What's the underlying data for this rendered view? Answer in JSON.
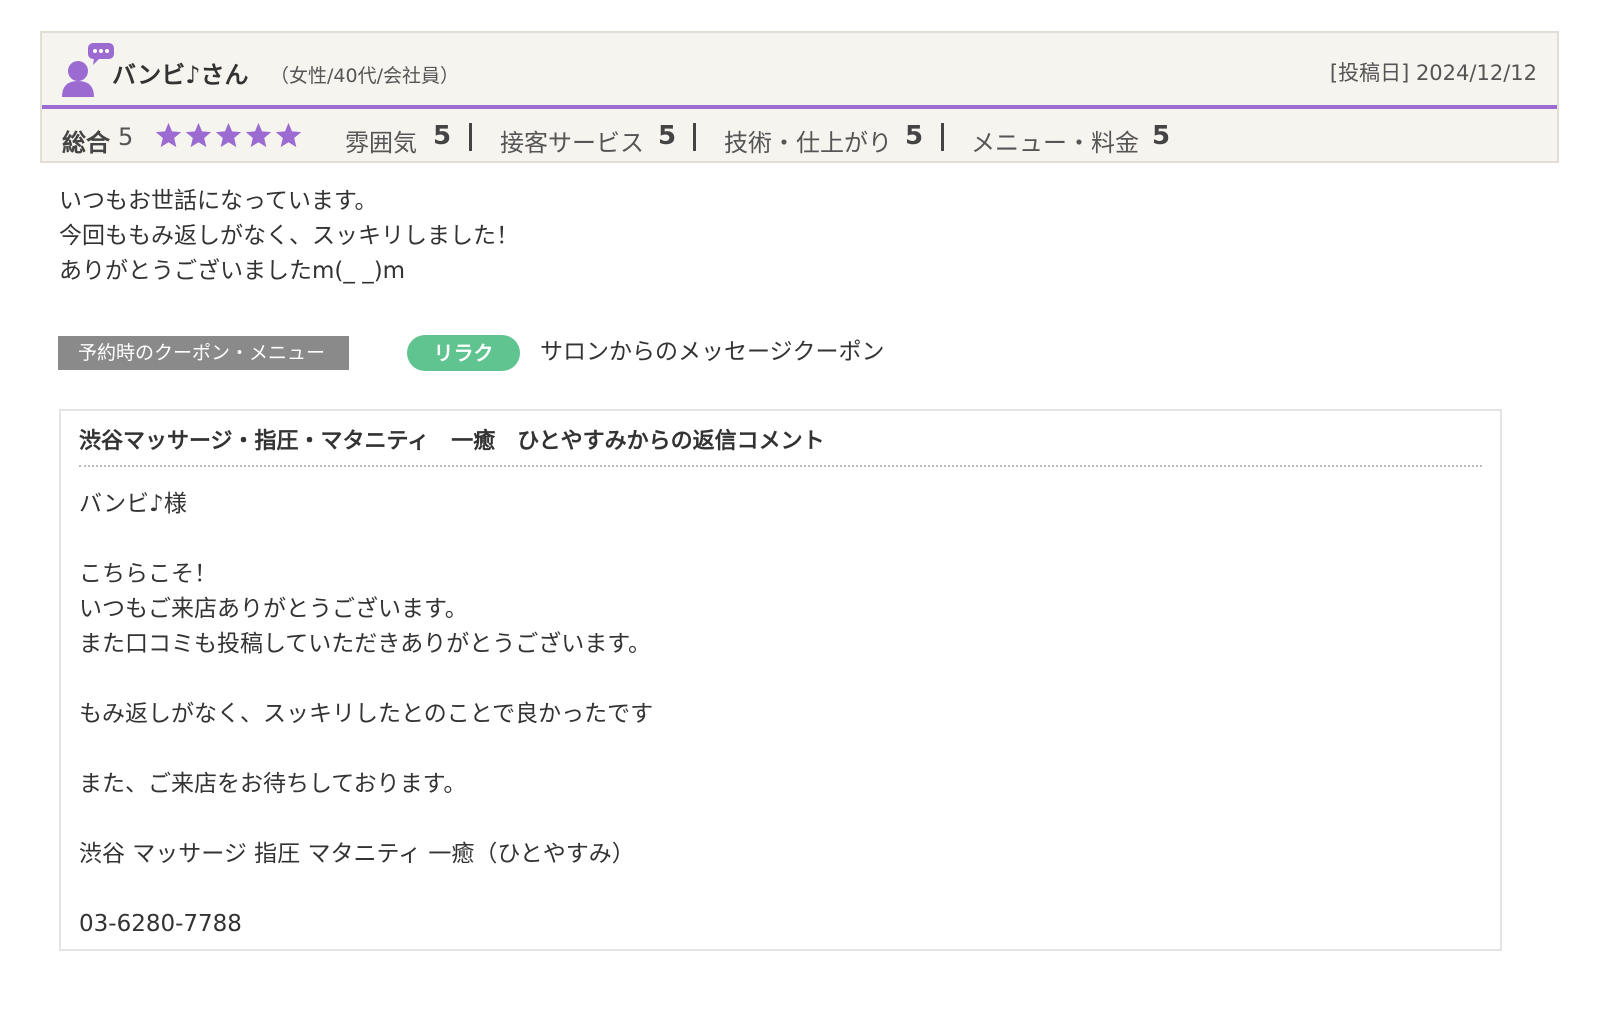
{
  "review": {
    "reviewer_name": "バンビ♪さん",
    "reviewer_attributes": "（女性/40代/会社員）",
    "post_date": "[投稿日] 2024/12/12",
    "overall_label": "総合",
    "overall_score": "5",
    "stars": 5,
    "star_color": "#9b6bd2",
    "accent_color": "#9b6bd2",
    "ratings": [
      {
        "label": "雰囲気",
        "score": "5"
      },
      {
        "label": "接客サービス",
        "score": "5"
      },
      {
        "label": "技術・仕上がり",
        "score": "5"
      },
      {
        "label": "メニュー・料金",
        "score": "5"
      }
    ],
    "comment": "いつもお世話になっています。\n今回ももみ返しがなく、スッキリしました！\nありがとうございましたm(_ _)m"
  },
  "coupon": {
    "section_label": "予約時のクーポン・メニュー",
    "badge": "リラク",
    "badge_color": "#5fc490",
    "name": "サロンからのメッセージクーポン"
  },
  "reply": {
    "title": "渋谷マッサージ・指圧・マタニティ　一癒　ひとやすみからの返信コメント",
    "body": "バンビ♪様\n\nこちらこそ！\nいつもご来店ありがとうございます。\nまた口コミも投稿していただきありがとうございます。\n\nもみ返しがなく、スッキリしたとのことで良かったです\n\nまた、ご来店をお待ちしております。\n\n渋谷 マッサージ 指圧 マタニティ 一癒（ひとやすみ）\n\n03-6280-7788"
  },
  "icons": {
    "avatar": "user-comment-icon",
    "star": "star-icon"
  }
}
